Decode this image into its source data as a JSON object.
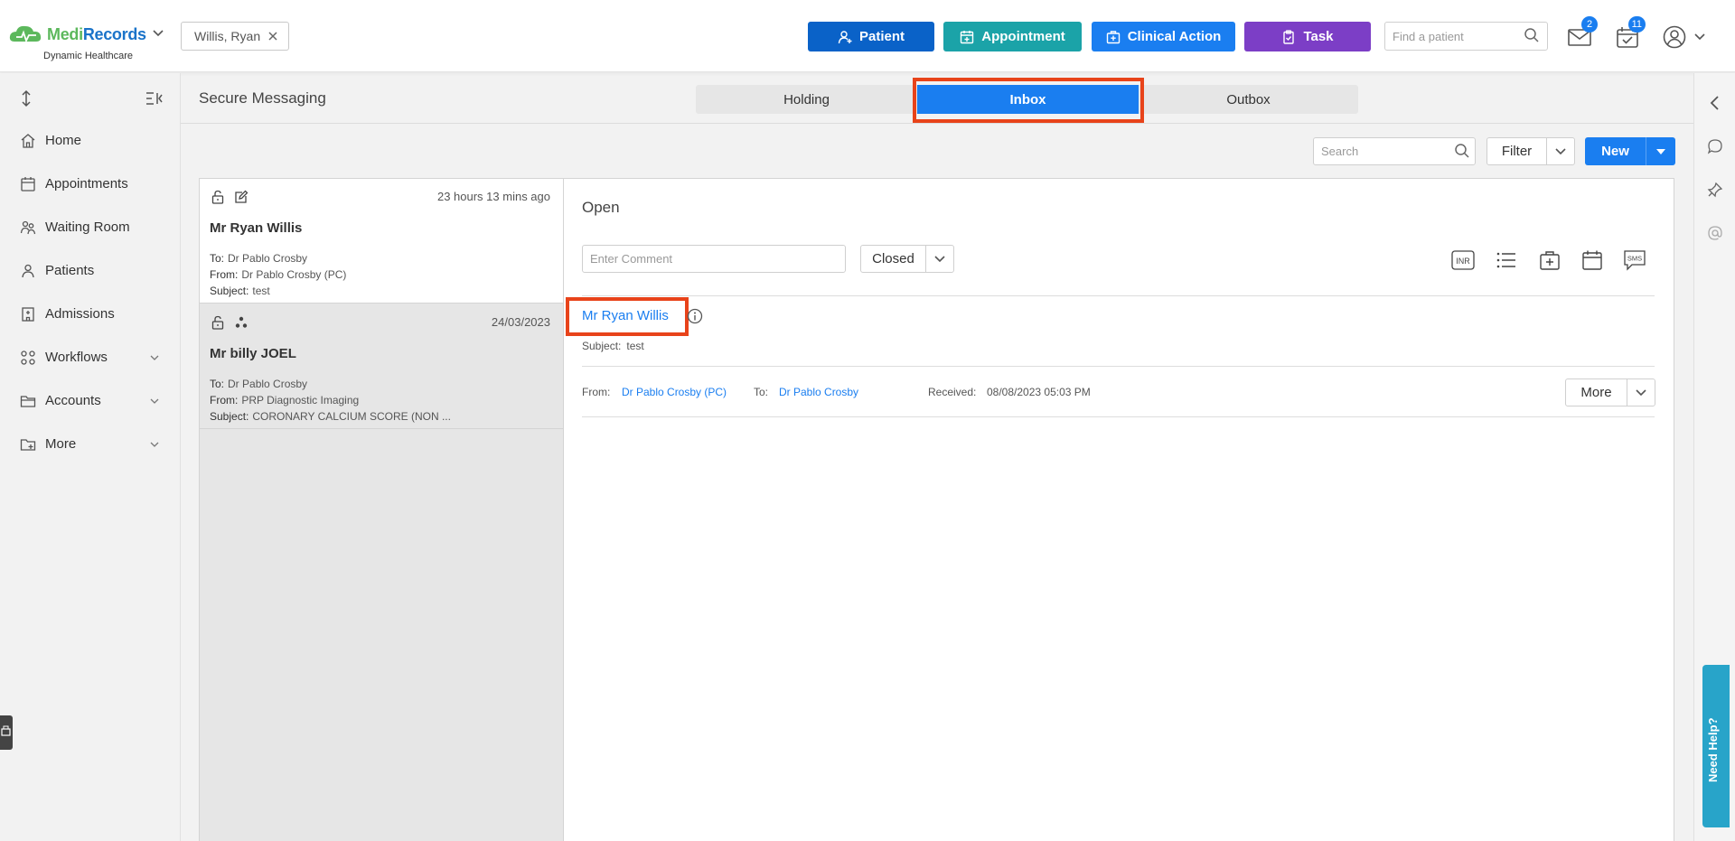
{
  "app": {
    "brand_part1": "Medi",
    "brand_part2": "Records",
    "brand_sub": "Dynamic Healthcare",
    "brand_colors": {
      "green": "#5cb85c",
      "blue": "#1a73c9"
    }
  },
  "header": {
    "patient_chip": "Willis, Ryan",
    "buttons": {
      "patient": "Patient",
      "appointment": "Appointment",
      "clinical_action": "Clinical Action",
      "task": "Task"
    },
    "button_colors": {
      "patient": "#0a62c8",
      "appointment": "#1ba3a8",
      "clinical_action": "#1a7ef0",
      "task": "#7c3ec6"
    },
    "find_patient_placeholder": "Find a patient",
    "mail_badge": "2",
    "calendar_badge": "11"
  },
  "sidebar": {
    "items": [
      {
        "label": "Home",
        "icon": "home-icon"
      },
      {
        "label": "Appointments",
        "icon": "calendar-icon"
      },
      {
        "label": "Waiting Room",
        "icon": "people-icon"
      },
      {
        "label": "Patients",
        "icon": "user-icon"
      },
      {
        "label": "Admissions",
        "icon": "building-icon"
      },
      {
        "label": "Workflows",
        "icon": "workflow-icon",
        "expandable": true
      },
      {
        "label": "Accounts",
        "icon": "folder-icon",
        "expandable": true
      },
      {
        "label": "More",
        "icon": "folder-plus-icon",
        "expandable": true
      }
    ]
  },
  "main": {
    "title": "Secure Messaging",
    "tabs": {
      "holding": "Holding",
      "inbox": "Inbox",
      "outbox": "Outbox"
    },
    "active_tab": "Inbox",
    "search_placeholder": "Search",
    "filter_label": "Filter",
    "new_label": "New"
  },
  "messages": [
    {
      "time": "23 hours 13 mins ago",
      "name": "Mr Ryan Willis",
      "to_label": "To:",
      "to": "Dr Pablo Crosby",
      "from_label": "From:",
      "from": "Dr Pablo Crosby (PC)",
      "subject_label": "Subject:",
      "subject": "test",
      "selected": true
    },
    {
      "time": "24/03/2023",
      "name": "Mr billy JOEL",
      "to_label": "To:",
      "to": "Dr Pablo Crosby",
      "from_label": "From:",
      "from": "PRP Diagnostic Imaging",
      "subject_label": "Subject:",
      "subject": "CORONARY CALCIUM SCORE (NON ...",
      "selected": false
    }
  ],
  "detail": {
    "status_heading": "Open",
    "comment_placeholder": "Enter Comment",
    "status_value": "Closed",
    "tools": {
      "inr": "INR",
      "sms": "SMS"
    },
    "patient_name": "Mr Ryan Willis",
    "subject_label": "Subject:",
    "subject": "test",
    "from_label": "From:",
    "from": "Dr Pablo Crosby (PC)",
    "to_label": "To:",
    "to": "Dr Pablo Crosby",
    "received_label": "Received:",
    "received": "08/08/2023 05:03 PM",
    "more_label": "More"
  },
  "help": {
    "label": "Need Help?"
  },
  "highlight_color": "#e8431a"
}
